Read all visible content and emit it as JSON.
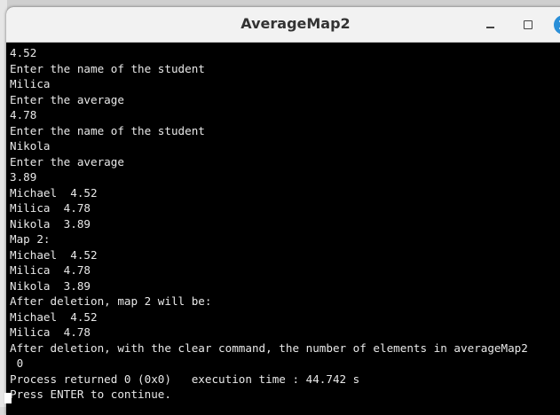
{
  "window": {
    "title": "AverageMap2"
  },
  "controls": {
    "minimize_icon": "minimize-icon",
    "maximize_icon": "maximize-icon",
    "close_icon": "close-icon",
    "close_color": "#2a8fd8"
  },
  "console": {
    "background": "#000000",
    "foreground": "#e8e8e8",
    "lines": [
      "4.52",
      "Enter the name of the student",
      "Milica",
      "Enter the average",
      "4.78",
      "Enter the name of the student",
      "Nikola",
      "Enter the average",
      "3.89",
      "Michael  4.52",
      "Milica  4.78",
      "Nikola  3.89",
      "Map 2:",
      "Michael  4.52",
      "Milica  4.78",
      "Nikola  3.89",
      "After deletion, map 2 will be:",
      "Michael  4.52",
      "Milica  4.78",
      "After deletion, with the clear command, the number of elements in averageMap2",
      " 0",
      "Process returned 0 (0x0)   execution time : 44.742 s",
      "Press ENTER to continue."
    ]
  }
}
